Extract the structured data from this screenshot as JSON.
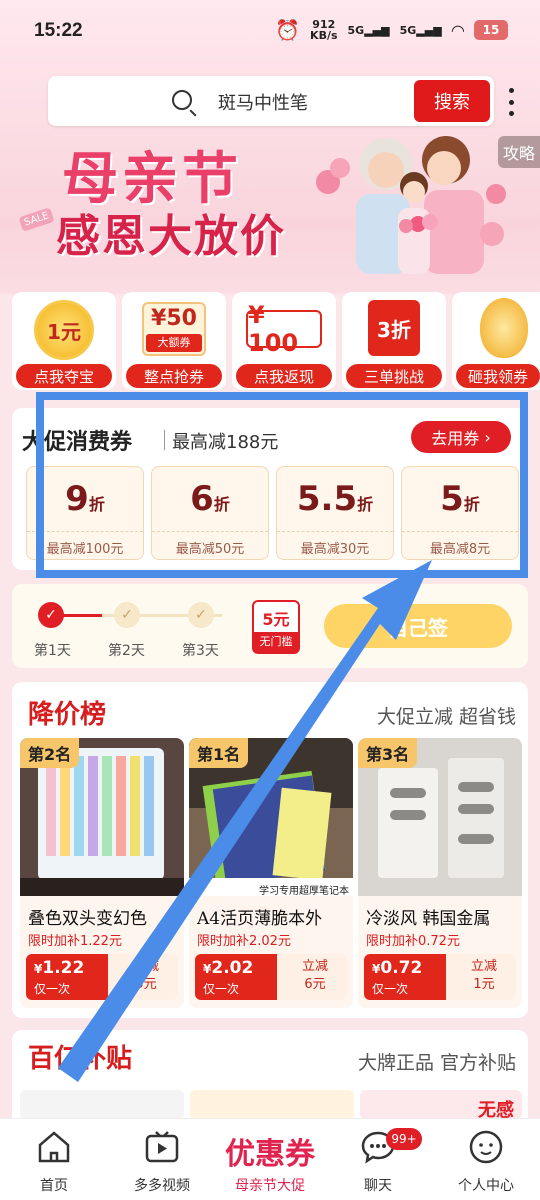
{
  "status_bar": {
    "time": "15:22",
    "speed_value": "912",
    "speed_unit": "KB/s",
    "net1": "5G",
    "net2": "5G",
    "battery": "15"
  },
  "search": {
    "query": "斑马中性笔",
    "button": "搜索"
  },
  "banner": {
    "title": "母亲节",
    "subtitle": "感恩大放价",
    "sale_tag": "SALE",
    "guide_tab": "攻略"
  },
  "quick_entries": [
    {
      "badge": "1元",
      "label": "点我夺宝"
    },
    {
      "badge": "¥50",
      "badge_sub": "大额券",
      "label": "整点抢券"
    },
    {
      "badge": "¥ 100",
      "label": "点我返现"
    },
    {
      "badge": "3折",
      "label": "三单挑战"
    },
    {
      "badge": "",
      "label": "砸我领券"
    }
  ],
  "coupons": {
    "title": "大促消费券",
    "subtitle": "最高减188元",
    "go_button": "去用券",
    "items": [
      {
        "value": "9",
        "unit": "折",
        "desc": "最高减100元"
      },
      {
        "value": "6",
        "unit": "折",
        "desc": "最高减50元"
      },
      {
        "value": "5.5",
        "unit": "折",
        "desc": "最高减30元"
      },
      {
        "value": "5",
        "unit": "折",
        "desc": "最高减8元"
      }
    ]
  },
  "checkin": {
    "days": [
      "第1天",
      "第2天",
      "第3天"
    ],
    "prize_value": "5元",
    "prize_note": "无门槛",
    "button": "自己签"
  },
  "price_drop": {
    "title": "降价榜",
    "subtitle": "大促立减 超省钱",
    "products": [
      {
        "rank": "第2名",
        "name": "叠色双头变幻色",
        "subsidy": "限时加补1.22元",
        "price_symbol": "¥",
        "price": "1.22",
        "price_note": "仅一次",
        "discount_line1": "立减",
        "discount_line2": "5元",
        "img_caption": ""
      },
      {
        "rank": "第1名",
        "name": "A4活页薄脆本外",
        "subsidy": "限时加补2.02元",
        "price_symbol": "¥",
        "price": "2.02",
        "price_note": "仅一次",
        "discount_line1": "立减",
        "discount_line2": "6元",
        "img_caption": "学习专用超厚笔记本"
      },
      {
        "rank": "第3名",
        "name": "冷淡风 韩国金属",
        "subsidy": "限时加补0.72元",
        "price_symbol": "¥",
        "price": "0.72",
        "price_note": "仅一次",
        "discount_line1": "立减",
        "discount_line2": "1元",
        "img_caption": ""
      }
    ]
  },
  "subsidy": {
    "title": "百亿补贴",
    "subtitle": "大牌正品 官方补贴",
    "tag": "无感"
  },
  "bottom_nav": [
    {
      "label": "首页"
    },
    {
      "label": "多多视频"
    },
    {
      "big": "优惠券",
      "label": "母亲节大促"
    },
    {
      "label": "聊天",
      "badge": "99+"
    },
    {
      "label": "个人中心"
    }
  ],
  "colors": {
    "accent": "#e01e25",
    "banner_pink": "#ea3f68",
    "highlight": "#4a8ce8"
  }
}
